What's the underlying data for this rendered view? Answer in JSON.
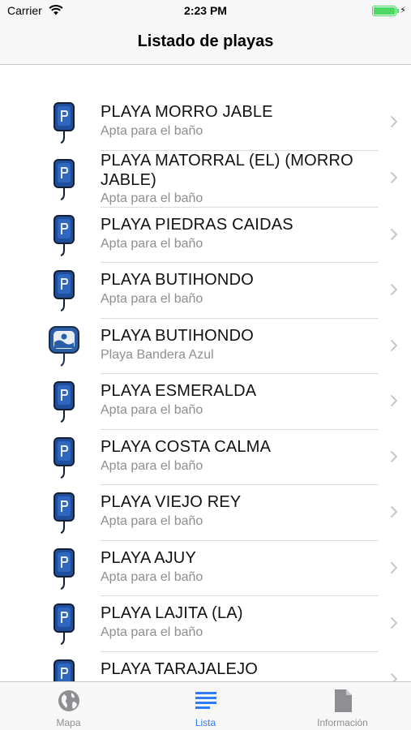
{
  "status_bar": {
    "carrier": "Carrier",
    "time": "2:23 PM",
    "battery_level": 1.0,
    "battery_color": "#4cd964",
    "wifi_icon": "wifi-icon",
    "charging_icon": "bolt-icon"
  },
  "nav": {
    "title": "Listado de playas"
  },
  "beaches": [
    {
      "name": "PLAYA MORRO JABLE",
      "status": "Apta para el baño",
      "icon": "bathing-pin-icon"
    },
    {
      "name": "PLAYA MATORRAL (EL) (MORRO JABLE)",
      "status": "Apta para el baño",
      "icon": "bathing-pin-icon"
    },
    {
      "name": "PLAYA PIEDRAS CAIDAS",
      "status": "Apta para el baño",
      "icon": "bathing-pin-icon"
    },
    {
      "name": "PLAYA BUTIHONDO",
      "status": "Apta para el baño",
      "icon": "bathing-pin-icon"
    },
    {
      "name": "PLAYA BUTIHONDO",
      "status": "Playa Bandera Azul",
      "icon": "blue-flag-pin-icon"
    },
    {
      "name": "PLAYA ESMERALDA",
      "status": "Apta para el baño",
      "icon": "bathing-pin-icon"
    },
    {
      "name": "PLAYA COSTA CALMA",
      "status": "Apta para el baño",
      "icon": "bathing-pin-icon"
    },
    {
      "name": "PLAYA VIEJO REY",
      "status": "Apta para el baño",
      "icon": "bathing-pin-icon"
    },
    {
      "name": "PLAYA AJUY",
      "status": "Apta para el baño",
      "icon": "bathing-pin-icon"
    },
    {
      "name": "PLAYA LAJITA (LA)",
      "status": "Apta para el baño",
      "icon": "bathing-pin-icon"
    },
    {
      "name": "PLAYA TARAJALEJO",
      "status": "",
      "icon": "bathing-pin-icon"
    }
  ],
  "tabs": [
    {
      "label": "Mapa",
      "icon": "globe-icon",
      "active": false
    },
    {
      "label": "Lista",
      "icon": "list-icon",
      "active": true
    },
    {
      "label": "Información",
      "icon": "document-icon",
      "active": false
    }
  ],
  "colors": {
    "accent": "#2f7bf5",
    "pin_blue": "#1f4f9c",
    "inactive": "#8e8e93"
  }
}
